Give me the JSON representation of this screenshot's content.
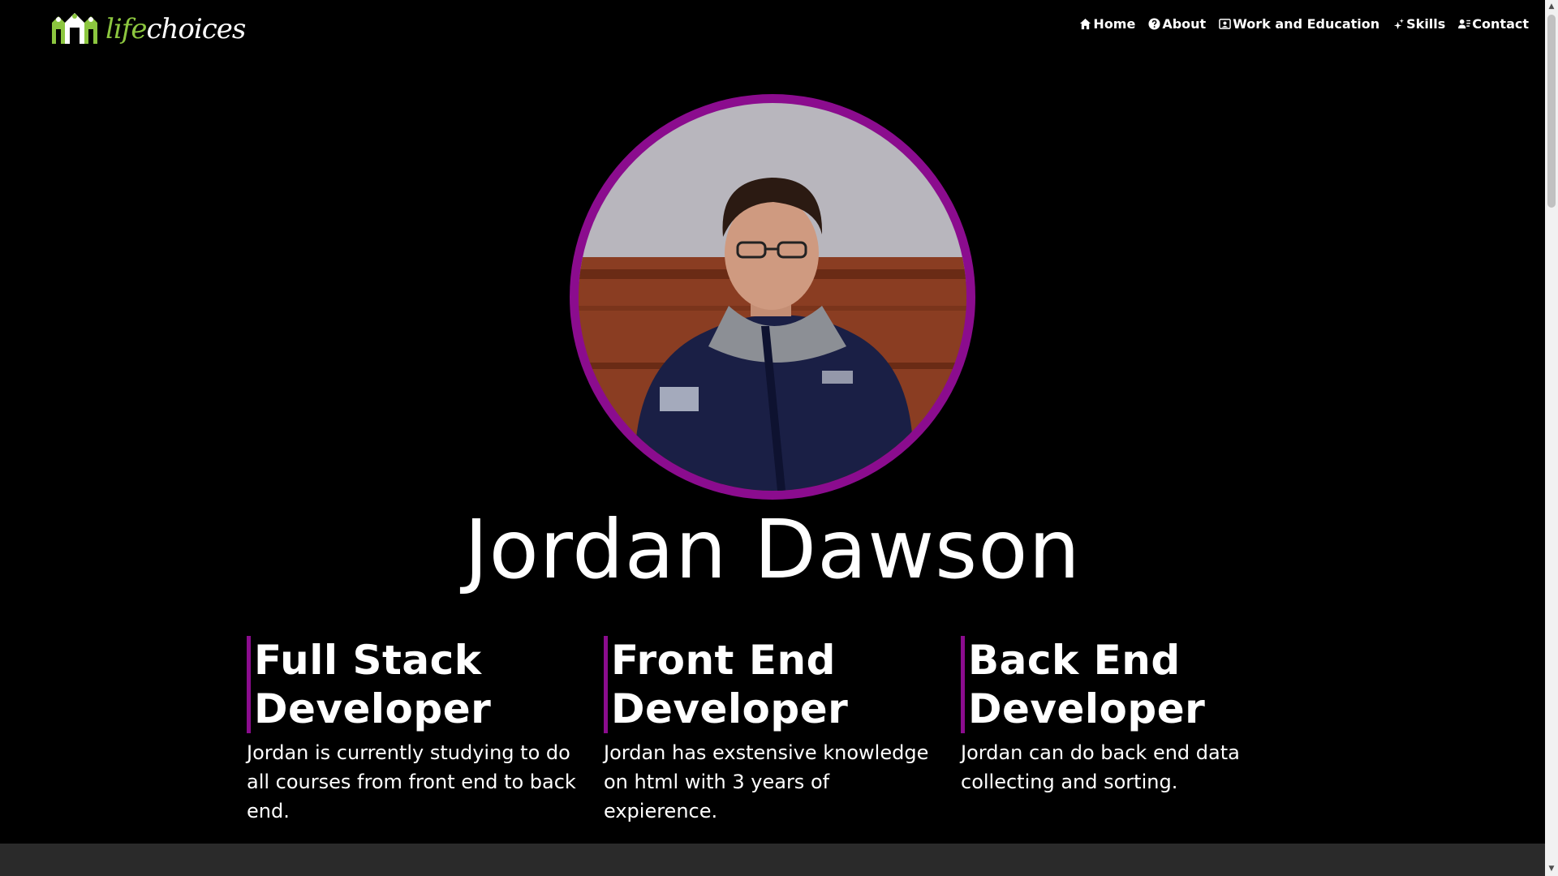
{
  "brand": {
    "logo_life": "life",
    "logo_choices": "choices",
    "logo_green": "#8cc63f"
  },
  "nav": [
    {
      "label": "Home",
      "icon": "home-icon"
    },
    {
      "label": "About",
      "icon": "question-circle-icon"
    },
    {
      "label": "Work and Education",
      "icon": "id-card-icon"
    },
    {
      "label": "Skills",
      "icon": "sparkle-icon"
    },
    {
      "label": "Contact",
      "icon": "contact-icon"
    }
  ],
  "profile": {
    "name": "Jordan Dawson",
    "ring_color": "#8b0c8e"
  },
  "roles": [
    {
      "title": "Full Stack Developer",
      "description": "Jordan is currently studying to do all courses from front end to back end."
    },
    {
      "title": "Front End Developer",
      "description": "Jordan has exstensive knowledge on html with 3 years of expierence."
    },
    {
      "title": "Back End Developer",
      "description": "Jordan can do back end data collecting and sorting."
    }
  ]
}
